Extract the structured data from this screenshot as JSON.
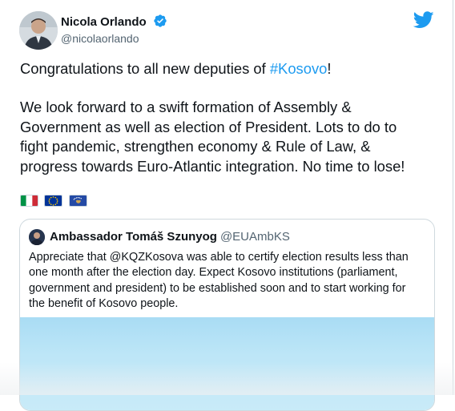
{
  "tweet": {
    "author_name": "Nicola Orlando",
    "author_handle": "@nicolaorlando",
    "line1_prefix": "Congratulations to all new deputies of ",
    "line1_hashtag": "#Kosovo",
    "line1_suffix": "!",
    "lines": [
      "We look forward to a swift formation of Assembly &",
      "Government as well as election of President. Lots to do to",
      "fight pandemic, strengthen economy & Rule of Law, &",
      "progress towards Euro-Atlantic integration. No time to lose!"
    ],
    "flags": [
      "italy-flag-icon",
      "eu-flag-icon",
      "kosovo-flag-icon"
    ]
  },
  "quote": {
    "author_name": "Ambassador Tomáš Szunyog",
    "author_handle": "@EUAmbKS",
    "lines": [
      "Appreciate that @KQZKosova was able to certify election results less than",
      "one month after the election day. Expect Kosovo institutions (parliament,",
      "government and president) to be established soon and to start working for",
      "the benefit of Kosovo people."
    ]
  },
  "colors": {
    "accent": "#1d9bf0",
    "text": "#0f1419",
    "muted": "#536471",
    "border": "#cfd9de"
  },
  "icons": {
    "verified": "verified-badge-icon",
    "brand": "twitter-bird-icon"
  }
}
